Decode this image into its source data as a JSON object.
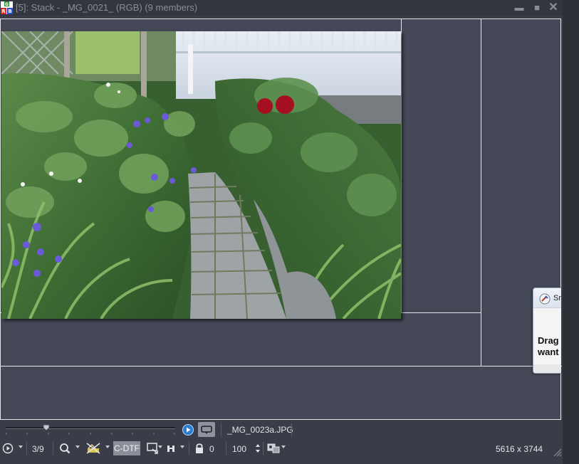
{
  "window": {
    "title": "[5]: Stack - _MG_0021_ (RGB) (9 members)",
    "app_icon": "rgb-channels-icon",
    "controls": {
      "minimize": "▬",
      "maximize": "■",
      "close": "✕"
    }
  },
  "image": {
    "description_icon": "garden-path-photo",
    "dimensions": "5616 x 3744"
  },
  "popup": {
    "title": "Sn",
    "body_line1": "Drag",
    "body_line2": "want"
  },
  "toolbar": {
    "slider_position": 0.24,
    "filename": "_MG_0023a.JPG",
    "frame_counter": "3/9",
    "color_profile": "C-DTF",
    "lock_value": "0",
    "zoom_value": "100"
  },
  "colors": {
    "background": "#454856",
    "grid_lines": "#e6e7ea",
    "toolbar_text": "#e2e4e8",
    "title_text": "#8a8e99",
    "accent_blue": "#2a7fd4"
  }
}
